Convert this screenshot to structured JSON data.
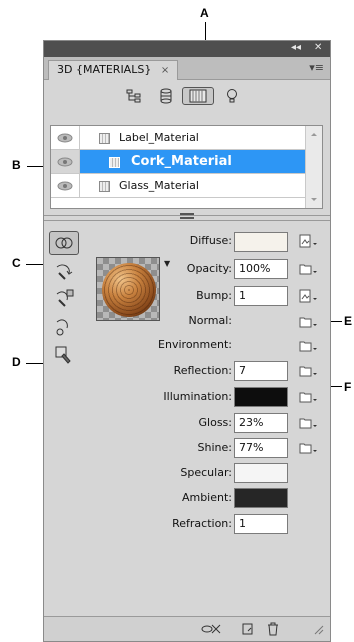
{
  "callouts": {
    "a": "A",
    "b": "B",
    "c": "C",
    "d": "D",
    "e": "E",
    "f": "F"
  },
  "panel": {
    "tab_title": "3D {MATERIALS}",
    "tab_close": "×",
    "window_controls": {
      "collapse": "◂◂",
      "close": "✕"
    },
    "panel_menu": "▾≡",
    "filter_icons": [
      "scene-icon",
      "mesh-icon",
      "materials-icon",
      "lights-icon"
    ],
    "materials": [
      {
        "name": "Label_Material",
        "visible": true,
        "selected": false
      },
      {
        "name": "Cork_Material",
        "visible": true,
        "selected": true
      },
      {
        "name": "Glass_Material",
        "visible": true,
        "selected": false
      }
    ],
    "tools": [
      "material-select-icon",
      "drop-material-icon",
      "drop-to-mesh-icon",
      "material-sample-icon",
      "select-material-icon"
    ],
    "properties": {
      "diffuse": {
        "label": "Diffuse:",
        "color": "#f5f2eb"
      },
      "opacity": {
        "label": "Opacity:",
        "value": "100%"
      },
      "bump": {
        "label": "Bump:",
        "value": "1"
      },
      "normal": {
        "label": "Normal:"
      },
      "environment": {
        "label": "Environment:"
      },
      "reflection": {
        "label": "Reflection:",
        "value": "7"
      },
      "illumination": {
        "label": "Illumination:",
        "color": "#0d0d0d"
      },
      "gloss": {
        "label": "Gloss:",
        "value": "23%"
      },
      "shine": {
        "label": "Shine:",
        "value": "77%"
      },
      "specular": {
        "label": "Specular:",
        "color": "#f5f5f5"
      },
      "ambient": {
        "label": "Ambient:",
        "color": "#262626"
      },
      "refraction": {
        "label": "Refraction:",
        "value": "1"
      }
    },
    "bottom_icons": [
      "toggle-overlays-icon",
      "new-material-icon",
      "delete-icon"
    ]
  }
}
